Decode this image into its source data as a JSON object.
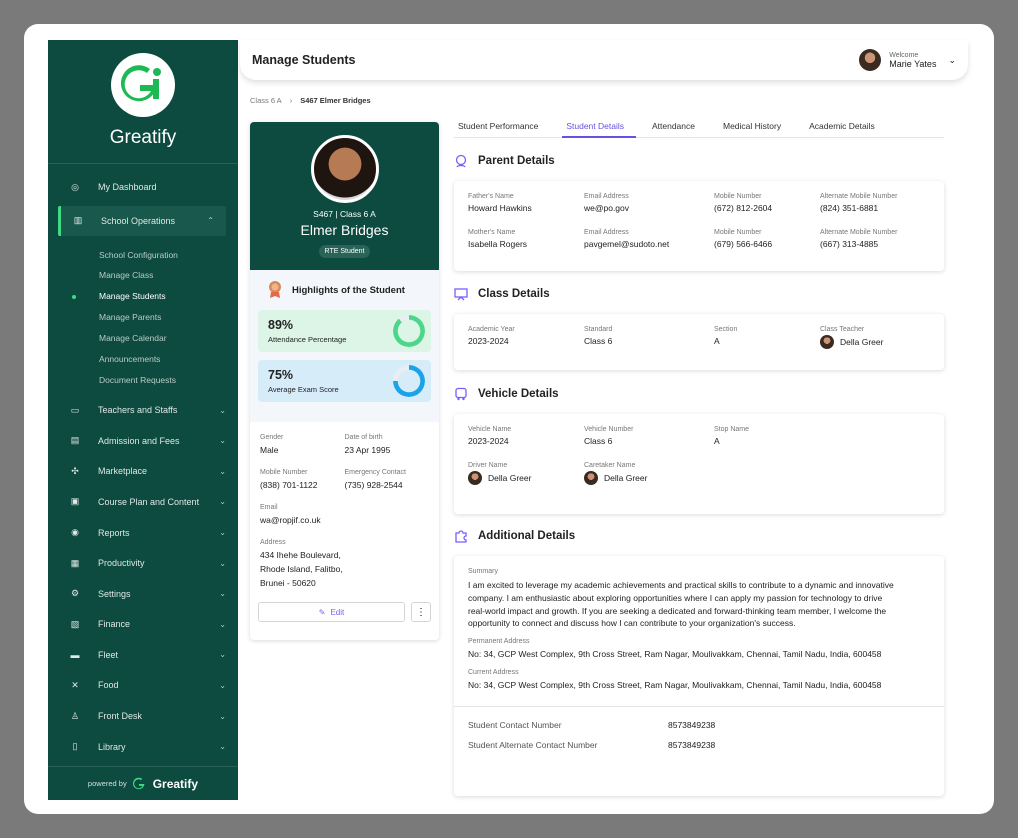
{
  "brand": "Greatify",
  "powered_by": "powered by",
  "sidebar": {
    "items": [
      {
        "label": "My Dashboard",
        "icon": "dashboard-icon"
      },
      {
        "label": "School Operations",
        "icon": "school-icon",
        "expanded": true
      },
      {
        "label": "Teachers and Staffs",
        "icon": "teacher-icon"
      },
      {
        "label": "Admission and Fees",
        "icon": "admission-icon"
      },
      {
        "label": "Marketplace",
        "icon": "marketplace-icon"
      },
      {
        "label": "Course Plan and Content",
        "icon": "course-icon"
      },
      {
        "label": "Reports",
        "icon": "reports-icon"
      },
      {
        "label": "Productivity",
        "icon": "productivity-icon"
      },
      {
        "label": "Settings",
        "icon": "settings-icon"
      },
      {
        "label": "Finance",
        "icon": "finance-icon"
      },
      {
        "label": "Fleet",
        "icon": "bus-icon"
      },
      {
        "label": "Food",
        "icon": "food-icon"
      },
      {
        "label": "Front Desk",
        "icon": "front-desk-icon"
      },
      {
        "label": "Library",
        "icon": "library-icon"
      }
    ],
    "sub_items": [
      "School Configuration",
      "Manage Class",
      "Manage Students",
      "Manage Parents",
      "Manage Calendar",
      "Announcements",
      "Document Requests"
    ]
  },
  "header": {
    "title": "Manage Students",
    "welcome": "Welcome",
    "user": "Marie Yates"
  },
  "breadcrumb": [
    "Class 6 A",
    "S467 Elmer Bridges"
  ],
  "profile": {
    "id_class": "S467 | Class 6 A",
    "name": "Elmer Bridges",
    "badge": "RTE Student",
    "highlights_title": "Highlights of the Student",
    "attendance": {
      "value": "89%",
      "label": "Attendance Percentage",
      "pct": 89
    },
    "exam": {
      "value": "75%",
      "label": "Average Exam Score",
      "pct": 75
    },
    "gender_k": "Gender",
    "gender": "Male",
    "dob_k": "Date of birth",
    "dob": "23 Apr 1995",
    "mobile_k": "Mobile Number",
    "mobile": "(838) 701-1122",
    "emerg_k": "Emergency Contact",
    "emerg": "(735) 928-2544",
    "email_k": "Email",
    "email": "wa@ropjif.co.uk",
    "address_k": "Address",
    "address_1": "434 Ihehe Boulevard,",
    "address_2": "Rhode Island,  Falitbo,",
    "address_3": "Brunei  - 50620",
    "edit": "Edit"
  },
  "tabs": [
    "Student Performance",
    "Student Details",
    "Attendance",
    "Medical History",
    "Academic Details"
  ],
  "parent": {
    "title": "Parent Details",
    "fields": [
      {
        "k": "Father's Name",
        "v": "Howard Hawkins"
      },
      {
        "k": "Email Address",
        "v": "we@po.gov"
      },
      {
        "k": "Mobile Number",
        "v": "(672) 812-2604"
      },
      {
        "k": "Alternate Mobile Number",
        "v": "(824) 351-6881"
      },
      {
        "k": "Mother's Name",
        "v": "Isabella Rogers"
      },
      {
        "k": "Email Address",
        "v": "pavgemel@sudoto.net"
      },
      {
        "k": "Mobile Number",
        "v": "(679) 566-6466"
      },
      {
        "k": "Alternate Mobile Number",
        "v": "(667) 313-4885"
      }
    ]
  },
  "class": {
    "title": "Class Details",
    "fields": [
      {
        "k": "Academic Year",
        "v": "2023-2024"
      },
      {
        "k": "Standard",
        "v": "Class 6"
      },
      {
        "k": "Section",
        "v": "A"
      },
      {
        "k": "Class Teacher",
        "v": "Della Greer"
      }
    ]
  },
  "vehicle": {
    "title": "Vehicle Details",
    "fields": [
      {
        "k": "Vehicle Name",
        "v": "2023-2024"
      },
      {
        "k": "Vehicle Number",
        "v": "Class 6"
      },
      {
        "k": "Stop Name",
        "v": "A"
      },
      {
        "k": "Driver Name",
        "v": "Della Greer"
      },
      {
        "k": "Caretaker Name",
        "v": "Della Greer"
      }
    ]
  },
  "additional": {
    "title": "Additional Details",
    "summary_k": "Summary",
    "summary": "I am excited to leverage my academic achievements and practical skills to contribute to a dynamic and innovative company. I am enthusiastic about exploring opportunities where I can apply my passion for technology to drive real-world impact and growth. If you are seeking a dedicated and forward-thinking team member, I welcome the opportunity to connect and discuss how I can contribute to your organization's success.",
    "perm_k": "Permanent Address",
    "perm": "No: 34, GCP West Complex, 9th Cross Street, Ram Nagar, Moulivakkam, Chennai, Tamil Nadu, India, 600458",
    "curr_k": "Current Address",
    "curr": "No: 34, GCP West Complex, 9th Cross Street, Ram Nagar, Moulivakkam, Chennai, Tamil Nadu, India, 600458",
    "contact_k": "Student Contact Number",
    "contact": "8573849238",
    "alt_k": "Student Alternate Contact Number",
    "alt": "8573849238"
  },
  "colors": {
    "sidebar": "#0d4a40",
    "accent": "#6b4ee6",
    "green": "#3ddc84",
    "ring_green": "#4cd68a",
    "ring_blue": "#1aa3e8"
  }
}
